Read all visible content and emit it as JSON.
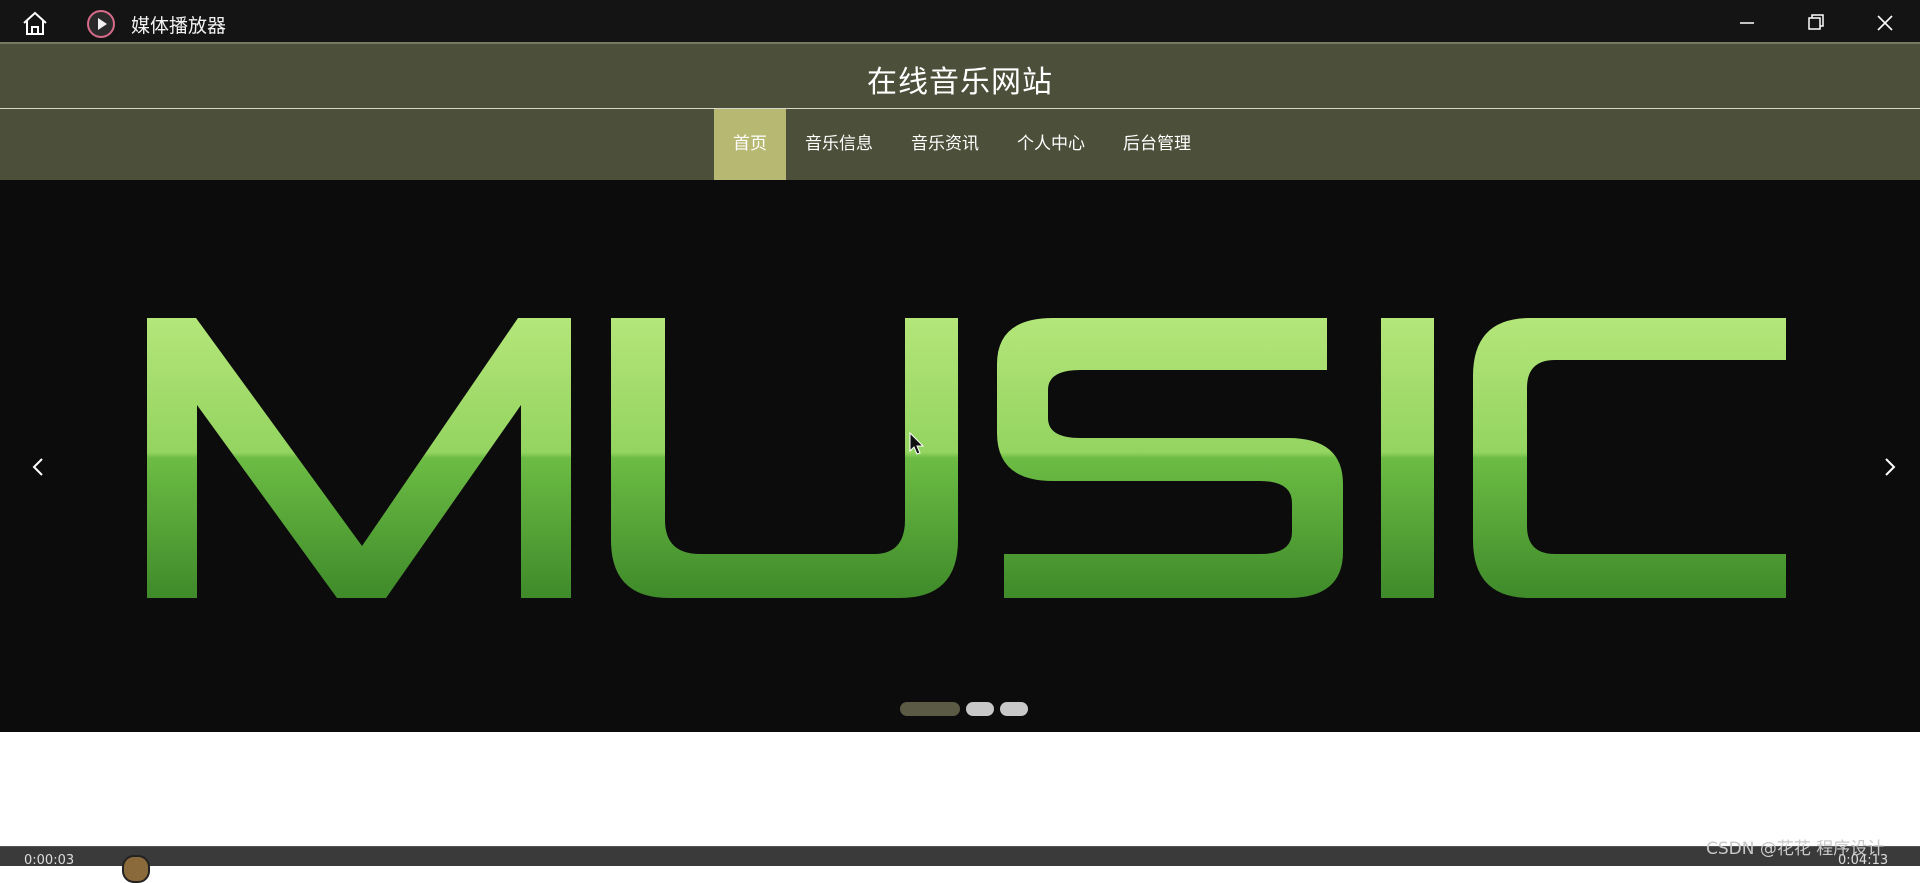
{
  "window": {
    "title": "媒体播放器",
    "home_icon": "home-icon",
    "app_icon": "media-player-icon",
    "controls": [
      "minimize-icon",
      "restore-icon",
      "close-icon"
    ]
  },
  "site": {
    "title": "在线音乐网站",
    "nav": [
      {
        "label": "首页",
        "active": true
      },
      {
        "label": "音乐信息",
        "active": false
      },
      {
        "label": "音乐资讯",
        "active": false
      },
      {
        "label": "个人中心",
        "active": false
      },
      {
        "label": "后台管理",
        "active": false
      }
    ]
  },
  "carousel": {
    "banner_text": "MUSIC",
    "slide_count": 3,
    "active_slide": 1,
    "prev_icon": "chevron-left-icon",
    "next_icon": "chevron-right-icon"
  },
  "player": {
    "time_elapsed": "0:00:03",
    "time_total": "0:04:13"
  },
  "watermark": "CSDN @花花 程序设计",
  "colors": {
    "header_bg": "#4c4f39",
    "nav_active": "#b7b872",
    "banner_bg": "#0c0c0c",
    "music_green_light": "#a8e06a",
    "music_green_dark": "#3f8a2a"
  }
}
